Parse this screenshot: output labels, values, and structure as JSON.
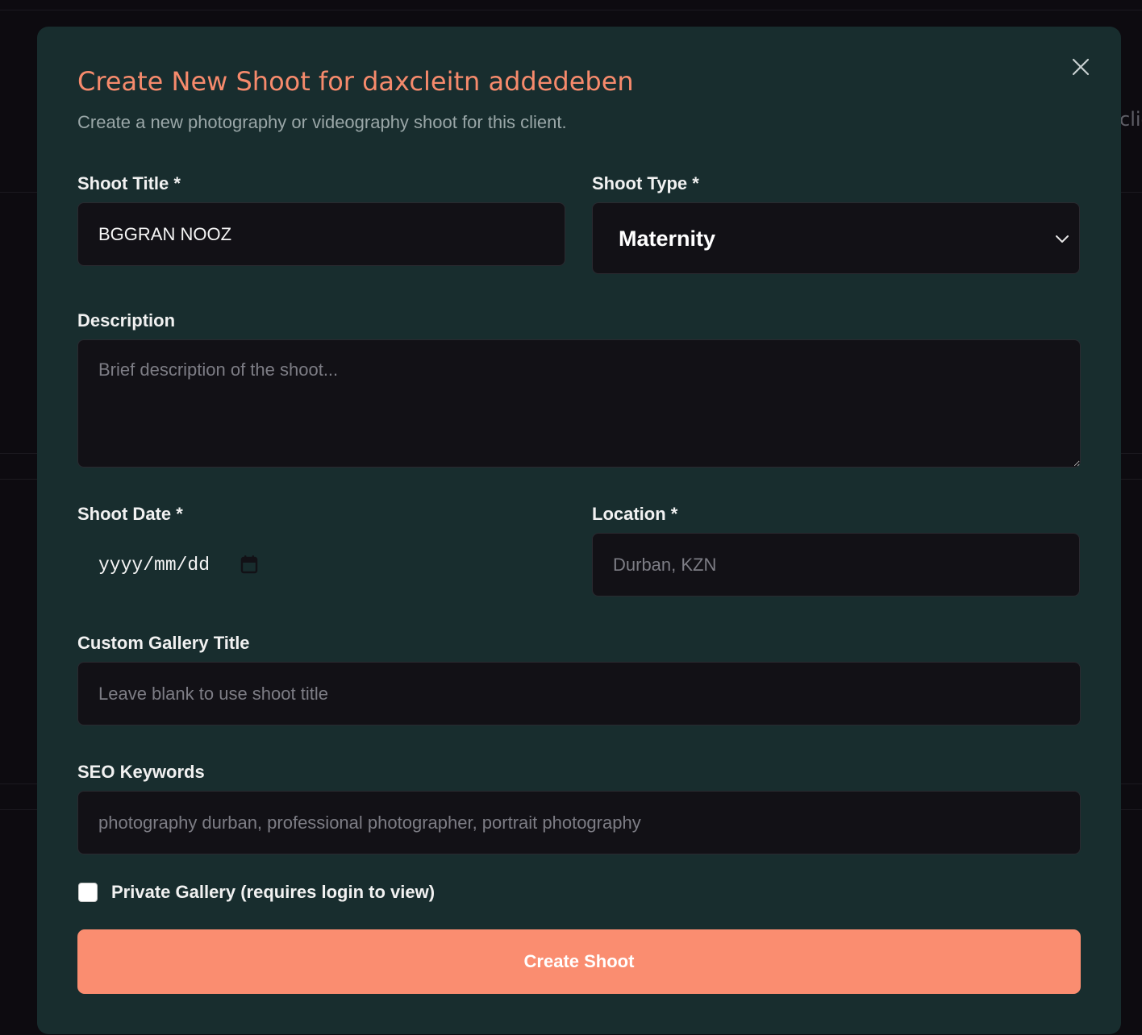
{
  "background": {
    "peek_text": "clie"
  },
  "modal": {
    "title": "Create New Shoot for daxcleitn addedeben",
    "subtitle": "Create a new photography or videography shoot for this client.",
    "close_icon": "close-icon"
  },
  "form": {
    "shoot_title": {
      "label": "Shoot Title *",
      "value": "BGGRAN NOOZ",
      "placeholder": ""
    },
    "shoot_type": {
      "label": "Shoot Type *",
      "selected": "Maternity",
      "icon": "chevron-down-icon"
    },
    "description": {
      "label": "Description",
      "value": "",
      "placeholder": "Brief description of the shoot..."
    },
    "shoot_date": {
      "label": "Shoot Date *",
      "display": "yyyy/mm/dd",
      "icon": "calendar-icon"
    },
    "location": {
      "label": "Location *",
      "value": "",
      "placeholder": "Durban, KZN"
    },
    "gallery_title": {
      "label": "Custom Gallery Title",
      "value": "",
      "placeholder": "Leave blank to use shoot title"
    },
    "seo_keywords": {
      "label": "SEO Keywords",
      "value": "",
      "placeholder": "photography durban, professional photographer, portrait photography"
    },
    "private_gallery": {
      "label": "Private Gallery (requires login to view)",
      "checked": false
    },
    "submit_label": "Create Shoot"
  },
  "colors": {
    "accent": "#fa8d70",
    "title": "#f68a6c",
    "modal_bg": "#182d2e",
    "field_bg": "#121116"
  }
}
